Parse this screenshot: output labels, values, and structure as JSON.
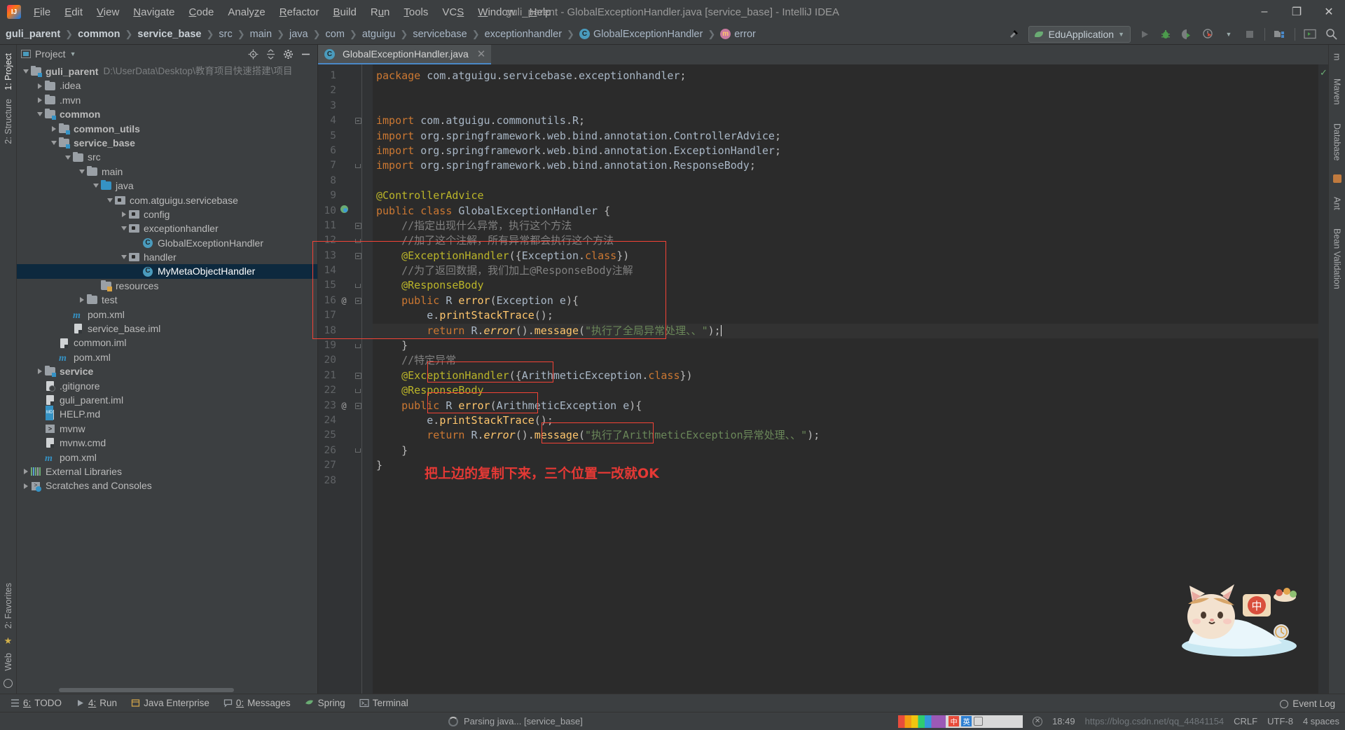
{
  "window": {
    "title": "guli_parent - GlobalExceptionHandler.java [service_base] - IntelliJ IDEA",
    "logo_alt": "intellij-idea-logo",
    "minimize": "–",
    "maximize": "❐",
    "close": "✕"
  },
  "menubar": [
    {
      "label": "File"
    },
    {
      "label": "Edit"
    },
    {
      "label": "View"
    },
    {
      "label": "Navigate"
    },
    {
      "label": "Code"
    },
    {
      "label": "Analyze"
    },
    {
      "label": "Refactor"
    },
    {
      "label": "Build"
    },
    {
      "label": "Run"
    },
    {
      "label": "Tools"
    },
    {
      "label": "VCS"
    },
    {
      "label": "Window"
    },
    {
      "label": "Help"
    }
  ],
  "breadcrumb": [
    {
      "label": "guli_parent",
      "bold": true
    },
    {
      "label": "common",
      "bold": true
    },
    {
      "label": "service_base",
      "bold": true
    },
    {
      "label": "src",
      "bold": false
    },
    {
      "label": "main",
      "bold": false
    },
    {
      "label": "java",
      "bold": false
    },
    {
      "label": "com",
      "bold": false
    },
    {
      "label": "atguigu",
      "bold": false
    },
    {
      "label": "servicebase",
      "bold": false
    },
    {
      "label": "exceptionhandler",
      "bold": false
    },
    {
      "label": "GlobalExceptionHandler",
      "bold": false,
      "icon": "class-icon",
      "icon_letter": "C"
    },
    {
      "label": "error",
      "bold": false,
      "icon": "method-icon",
      "icon_letter": "m"
    }
  ],
  "toolbar": {
    "run_config": "EduApplication",
    "build_icon": "hammer-icon",
    "run_icon": "run-icon",
    "debug_icon": "debug-icon",
    "coverage_icon": "run-with-coverage-icon",
    "profiler_icon": "profiler-icon",
    "stop_icon": "stop-icon",
    "project_structure_icon": "project-structure-icon",
    "terminal_icon": "terminal-icon",
    "search_icon": "search-everywhere-icon"
  },
  "left_strips": {
    "top": [
      {
        "label": "1: Project",
        "active": true
      },
      {
        "label": "2: Structure",
        "active": false
      }
    ],
    "bottom": [
      {
        "label": "2: Favorites",
        "active": false
      },
      {
        "label": "Web",
        "active": false
      }
    ]
  },
  "right_strips": [
    {
      "label": "m",
      "name": "maven-strip"
    },
    {
      "label": "Maven",
      "name": "maven-tool"
    },
    {
      "label": "Database",
      "name": "database-tool"
    },
    {
      "label": "Ant",
      "name": "ant-tool"
    },
    {
      "label": "Bean Validation",
      "name": "bean-validation-tool"
    }
  ],
  "project_panel": {
    "title": "Project",
    "actions": [
      "locate-icon",
      "collapse-all-icon",
      "settings-icon",
      "hide-icon"
    ],
    "tree": [
      {
        "depth": 0,
        "arrow": "down",
        "icon": "module-folder",
        "label": "guli_parent",
        "bold": true,
        "path": "D:\\UserData\\Desktop\\教育项目快速搭建\\项目"
      },
      {
        "depth": 1,
        "arrow": "right",
        "icon": "folder",
        "label": ".idea",
        "bold": false
      },
      {
        "depth": 1,
        "arrow": "right",
        "icon": "folder",
        "label": ".mvn",
        "bold": false
      },
      {
        "depth": 1,
        "arrow": "down",
        "icon": "module-folder",
        "label": "common",
        "bold": true
      },
      {
        "depth": 2,
        "arrow": "right",
        "icon": "module-folder",
        "label": "common_utils",
        "bold": true
      },
      {
        "depth": 2,
        "arrow": "down",
        "icon": "module-folder",
        "label": "service_base",
        "bold": true
      },
      {
        "depth": 3,
        "arrow": "down",
        "icon": "folder",
        "label": "src",
        "bold": false
      },
      {
        "depth": 4,
        "arrow": "down",
        "icon": "folder",
        "label": "main",
        "bold": false
      },
      {
        "depth": 5,
        "arrow": "down",
        "icon": "source-folder",
        "label": "java",
        "bold": false
      },
      {
        "depth": 6,
        "arrow": "down",
        "icon": "package",
        "label": "com.atguigu.servicebase",
        "bold": false
      },
      {
        "depth": 7,
        "arrow": "right",
        "icon": "package",
        "label": "config",
        "bold": false
      },
      {
        "depth": 7,
        "arrow": "down",
        "icon": "package",
        "label": "exceptionhandler",
        "bold": false
      },
      {
        "depth": 8,
        "arrow": "none",
        "icon": "class",
        "label": "GlobalExceptionHandler",
        "bold": false
      },
      {
        "depth": 7,
        "arrow": "down",
        "icon": "package",
        "label": "handler",
        "bold": false
      },
      {
        "depth": 8,
        "arrow": "none",
        "icon": "class",
        "label": "MyMetaObjectHandler",
        "bold": false,
        "selected": true
      },
      {
        "depth": 5,
        "arrow": "none",
        "icon": "resource-folder",
        "label": "resources",
        "bold": false
      },
      {
        "depth": 4,
        "arrow": "right",
        "icon": "folder",
        "label": "test",
        "bold": false
      },
      {
        "depth": 3,
        "arrow": "none",
        "icon": "maven",
        "label": "pom.xml",
        "bold": false
      },
      {
        "depth": 3,
        "arrow": "none",
        "icon": "file",
        "label": "service_base.iml",
        "bold": false
      },
      {
        "depth": 2,
        "arrow": "none",
        "icon": "file",
        "label": "common.iml",
        "bold": false
      },
      {
        "depth": 2,
        "arrow": "none",
        "icon": "maven",
        "label": "pom.xml",
        "bold": false
      },
      {
        "depth": 1,
        "arrow": "right",
        "icon": "module-folder",
        "label": "service",
        "bold": true
      },
      {
        "depth": 1,
        "arrow": "none",
        "icon": "gitignore",
        "label": ".gitignore",
        "bold": false
      },
      {
        "depth": 1,
        "arrow": "none",
        "icon": "file",
        "label": "guli_parent.iml",
        "bold": false
      },
      {
        "depth": 1,
        "arrow": "none",
        "icon": "markdown",
        "label": "HELP.md",
        "bold": false
      },
      {
        "depth": 1,
        "arrow": "none",
        "icon": "shell",
        "label": "mvnw",
        "bold": false
      },
      {
        "depth": 1,
        "arrow": "none",
        "icon": "file",
        "label": "mvnw.cmd",
        "bold": false
      },
      {
        "depth": 1,
        "arrow": "none",
        "icon": "maven",
        "label": "pom.xml",
        "bold": false
      },
      {
        "depth": 0,
        "arrow": "right",
        "icon": "libraries",
        "label": "External Libraries",
        "bold": false
      },
      {
        "depth": 0,
        "arrow": "right",
        "icon": "scratches",
        "label": "Scratches and Consoles",
        "bold": false
      }
    ]
  },
  "editor": {
    "tab": {
      "label": "GlobalExceptionHandler.java",
      "icon": "class-icon",
      "icon_letter": "C",
      "close": "✕"
    },
    "lines": [
      {
        "n": 1,
        "marker": "",
        "fold": "",
        "text": "package com.atguigu.servicebase.exceptionhandler;"
      },
      {
        "n": 2,
        "marker": "",
        "fold": "",
        "text": ""
      },
      {
        "n": 3,
        "marker": "",
        "fold": "",
        "text": ""
      },
      {
        "n": 4,
        "marker": "",
        "fold": "foldtop",
        "text": "import com.atguigu.commonutils.R;"
      },
      {
        "n": 5,
        "marker": "",
        "fold": "",
        "text": "import org.springframework.web.bind.annotation.ControllerAdvice;"
      },
      {
        "n": 6,
        "marker": "",
        "fold": "",
        "text": "import org.springframework.web.bind.annotation.ExceptionHandler;"
      },
      {
        "n": 7,
        "marker": "",
        "fold": "foldbot",
        "text": "import org.springframework.web.bind.annotation.ResponseBody;"
      },
      {
        "n": 8,
        "marker": "",
        "fold": "",
        "text": ""
      },
      {
        "n": 9,
        "marker": "",
        "fold": "",
        "text": "@ControllerAdvice"
      },
      {
        "n": 10,
        "marker": "bean",
        "fold": "",
        "text": "public class GlobalExceptionHandler {"
      },
      {
        "n": 11,
        "marker": "",
        "fold": "foldtop",
        "text": "    //指定出现什么异常，执行这个方法"
      },
      {
        "n": 12,
        "marker": "",
        "fold": "foldbot",
        "text": "    //加了这个注解，所有异常都会执行这个方法"
      },
      {
        "n": 13,
        "marker": "",
        "fold": "foldtop",
        "text": "    @ExceptionHandler({Exception.class})"
      },
      {
        "n": 14,
        "marker": "",
        "fold": "",
        "text": "    //为了返回数据，我们加上@ResponseBody注解"
      },
      {
        "n": 15,
        "marker": "",
        "fold": "foldbot",
        "text": "    @ResponseBody"
      },
      {
        "n": 16,
        "marker": "@",
        "fold": "foldtop",
        "text": "    public R error(Exception e){"
      },
      {
        "n": 17,
        "marker": "",
        "fold": "",
        "text": "        e.printStackTrace();"
      },
      {
        "n": 18,
        "marker": "",
        "fold": "",
        "text": "        return R.error().message(\"执行了全局异常处理、、\");",
        "highlight": true,
        "caret": true
      },
      {
        "n": 19,
        "marker": "",
        "fold": "foldbot",
        "text": "    }"
      },
      {
        "n": 20,
        "marker": "",
        "fold": "",
        "text": "    //特定异常"
      },
      {
        "n": 21,
        "marker": "",
        "fold": "foldtop",
        "text": "    @ExceptionHandler({ArithmeticException.class})"
      },
      {
        "n": 22,
        "marker": "",
        "fold": "foldbot",
        "text": "    @ResponseBody"
      },
      {
        "n": 23,
        "marker": "@",
        "fold": "foldtop",
        "text": "    public R error(ArithmeticException e){"
      },
      {
        "n": 24,
        "marker": "",
        "fold": "",
        "text": "        e.printStackTrace();"
      },
      {
        "n": 25,
        "marker": "",
        "fold": "",
        "text": "        return R.error().message(\"执行了ArithmeticException异常处理、、\");"
      },
      {
        "n": 26,
        "marker": "",
        "fold": "foldbot",
        "text": "    }"
      },
      {
        "n": 27,
        "marker": "",
        "fold": "",
        "text": "}"
      },
      {
        "n": 28,
        "marker": "",
        "fold": "",
        "text": ""
      }
    ],
    "annotation_text": "把上边的复制下来，三个位置一改就OK",
    "annotation_color": "#e53935",
    "inspection_status": "✓"
  },
  "bottom_toolwindows": [
    {
      "key": "6",
      "label": "TODO",
      "icon": "todo-icon"
    },
    {
      "key": "4",
      "label": "Run",
      "icon": "run-icon"
    },
    {
      "key": "",
      "label": "Java Enterprise",
      "icon": "java-enterprise-icon"
    },
    {
      "key": "0",
      "label": "Messages",
      "icon": "messages-icon"
    },
    {
      "key": "",
      "label": "Spring",
      "icon": "spring-icon"
    },
    {
      "key": "",
      "label": "Terminal",
      "icon": "terminal-icon"
    }
  ],
  "statusbar": {
    "progress_text": "Parsing java... [service_base]",
    "time": "18:49",
    "encoding": "UTF-8",
    "line_sep": "CRLF",
    "indent": "4 spaces",
    "event_log": "Event Log",
    "watermark": "https://blog.csdn.net/qq_44841154",
    "ime_label_cn": "中",
    "ime_label_en": "英"
  }
}
